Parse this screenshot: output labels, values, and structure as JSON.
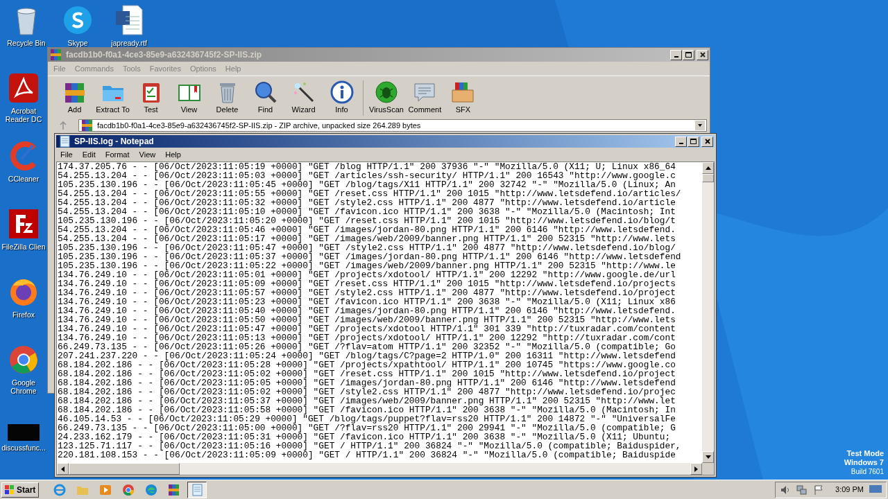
{
  "desktop": {
    "icons": [
      {
        "kind": "recycle-bin",
        "label": "Recycle Bin"
      },
      {
        "kind": "skype",
        "label": "Skype"
      },
      {
        "kind": "word-document",
        "label": "japready.rtf"
      },
      {
        "kind": "acrobat",
        "label": "Acrobat Reader DC"
      },
      {
        "kind": "ccleaner",
        "label": "CCleaner"
      },
      {
        "kind": "filezilla",
        "label": "FileZilla Clien"
      },
      {
        "kind": "firefox",
        "label": "Firefox"
      },
      {
        "kind": "chrome",
        "label": "Google Chrome"
      },
      {
        "kind": "black-file",
        "label": "discussfunc..."
      }
    ],
    "os_notice": [
      "Test Mode",
      "Windows 7",
      "Build 7601"
    ]
  },
  "archiver": {
    "title": "facdb1b0-f0a1-4ce3-85e9-a632436745f2-SP-IIS.zip",
    "menu": [
      "File",
      "Commands",
      "Tools",
      "Favorites",
      "Options",
      "Help"
    ],
    "toolbar_groups": [
      {
        "buttons": [
          {
            "kind": "add",
            "label": "Add"
          },
          {
            "kind": "extract",
            "label": "Extract To"
          },
          {
            "kind": "test",
            "label": "Test"
          },
          {
            "kind": "view",
            "label": "View"
          },
          {
            "kind": "delete",
            "label": "Delete"
          },
          {
            "kind": "find",
            "label": "Find"
          },
          {
            "kind": "wizard",
            "label": "Wizard"
          },
          {
            "kind": "info",
            "label": "Info"
          }
        ]
      },
      {
        "buttons": [
          {
            "kind": "virusscan",
            "label": "VirusScan"
          },
          {
            "kind": "comment",
            "label": "Comment"
          },
          {
            "kind": "sfx",
            "label": "SFX"
          }
        ]
      }
    ],
    "path": "facdb1b0-f0a1-4ce3-85e9-a632436745f2-SP-IIS.zip - ZIP archive, unpacked size 264.289 bytes"
  },
  "notepad": {
    "title": "SP-IIS.log - Notepad",
    "menu": [
      "File",
      "Edit",
      "Format",
      "View",
      "Help"
    ],
    "lines": [
      "174.37.205.76 - - [06/Oct/2023:11:05:19 +0000] \"GET /blog HTTP/1.1\" 200 37936 \"-\" \"Mozilla/5.0 (X11; U; Linux x86_64",
      "54.255.13.204 - - [06/Oct/2023:11:05:03 +0000] \"GET /articles/ssh-security/ HTTP/1.1\" 200 16543 \"http://www.google.c",
      "105.235.130.196 - - [06/Oct/2023:11:05:45 +0000] \"GET /blog/tags/X11 HTTP/1.1\" 200 32742 \"-\" \"Mozilla/5.0 (Linux; An",
      "54.255.13.204 - - [06/Oct/2023:11:05:55 +0000] \"GET /reset.css HTTP/1.1\" 200 1015 \"http://www.letsdefend.io/articles/",
      "54.255.13.204 - - [06/Oct/2023:11:05:32 +0000] \"GET /style2.css HTTP/1.1\" 200 4877 \"http://www.letsdefend.io/article",
      "54.255.13.204 - - [06/Oct/2023:11:05:10 +0000] \"GET /favicon.ico HTTP/1.1\" 200 3638 \"-\" \"Mozilla/5.0 (Macintosh; Int",
      "105.235.130.196 - - [06/Oct/2023:11:05:20 +0000] \"GET /reset.css HTTP/1.1\" 200 1015 \"http://www.letsdefend.io/blog/t",
      "54.255.13.204 - - [06/Oct/2023:11:05:46 +0000] \"GET /images/jordan-80.png HTTP/1.1\" 200 6146 \"http://www.letsdefend.",
      "54.255.13.204 - - [06/Oct/2023:11:05:17 +0000] \"GET /images/web/2009/banner.png HTTP/1.1\" 200 52315 \"http://www.lets",
      "105.235.130.196 - - [06/Oct/2023:11:05:47 +0000] \"GET /style2.css HTTP/1.1\" 200 4877 \"http://www.letsdefend.io/blog/",
      "105.235.130.196 - - [06/Oct/2023:11:05:37 +0000] \"GET /images/jordan-80.png HTTP/1.1\" 200 6146 \"http://www.letsdefend",
      "105.235.130.196 - - [06/Oct/2023:11:05:22 +0000] \"GET /images/web/2009/banner.png HTTP/1.1\" 200 52315 \"http://www.le",
      "134.76.249.10 - - [06/Oct/2023:11:05:01 +0000] \"GET /projects/xdotool/ HTTP/1.1\" 200 12292 \"http://www.google.de/url",
      "134.76.249.10 - - [06/Oct/2023:11:05:09 +0000] \"GET /reset.css HTTP/1.1\" 200 1015 \"http://www.letsdefend.io/projects",
      "134.76.249.10 - - [06/Oct/2023:11:05:57 +0000] \"GET /style2.css HTTP/1.1\" 200 4877 \"http://www.letsdefend.io/project",
      "134.76.249.10 - - [06/Oct/2023:11:05:23 +0000] \"GET /favicon.ico HTTP/1.1\" 200 3638 \"-\" \"Mozilla/5.0 (X11; Linux x86",
      "134.76.249.10 - - [06/Oct/2023:11:05:40 +0000] \"GET /images/jordan-80.png HTTP/1.1\" 200 6146 \"http://www.letsdefend.",
      "134.76.249.10 - - [06/Oct/2023:11:05:50 +0000] \"GET /images/web/2009/banner.png HTTP/1.1\" 200 52315 \"http://www.lets",
      "134.76.249.10 - - [06/Oct/2023:11:05:47 +0000] \"GET /projects/xdotool HTTP/1.1\" 301 339 \"http://tuxradar.com/content",
      "134.76.249.10 - - [06/Oct/2023:11:05:13 +0000] \"GET /projects/xdotool/ HTTP/1.1\" 200 12292 \"http://tuxradar.com/cont",
      "66.249.73.135 - - [06/Oct/2023:11:05:26 +0000] \"GET /?flav=atom HTTP/1.1\" 200 32352 \"-\" \"Mozilla/5.0 (compatible; Go",
      "207.241.237.220 - - [06/Oct/2023:11:05:24 +0000] \"GET /blog/tags/C?page=2 HTTP/1.0\" 200 16311 \"http://www.letsdefend",
      "68.184.202.186 - - [06/Oct/2023:11:05:28 +0000] \"GET /projects/xpathtool/ HTTP/1.1\" 200 10745 \"https://www.google.co",
      "68.184.202.186 - - [06/Oct/2023:11:05:02 +0000] \"GET /reset.css HTTP/1.1\" 200 1015 \"http://www.letsdefend.io/project",
      "68.184.202.186 - - [06/Oct/2023:11:05:05 +0000] \"GET /images/jordan-80.png HTTP/1.1\" 200 6146 \"http://www.letsdefend",
      "68.184.202.186 - - [06/Oct/2023:11:05:02 +0000] \"GET /style2.css HTTP/1.1\" 200 4877 \"http://www.letsdefend.io/projec",
      "68.184.202.186 - - [06/Oct/2023:11:05:37 +0000] \"GET /images/web/2009/banner.png HTTP/1.1\" 200 52315 \"http://www.let",
      "68.184.202.186 - - [06/Oct/2023:11:05:58 +0000] \"GET /favicon.ico HTTP/1.1\" 200 3638 \"-\" \"Mozilla/5.0 (Macintosh; In",
      "46.105.14.53 - - [06/Oct/2023:11:05:29 +0000] \"GET /blog/tags/puppet?flav=rss20 HTTP/1.1\" 200 14872 \"-\" \"UniversalFe",
      "66.249.73.135 - - [06/Oct/2023:11:05:00 +0000] \"GET /?flav=rss20 HTTP/1.1\" 200 29941 \"-\" \"Mozilla/5.0 (compatible; G",
      "24.233.162.179 - - [06/Oct/2023:11:05:31 +0000] \"GET /favicon.ico HTTP/1.1\" 200 3638 \"-\" \"Mozilla/5.0 (X11; Ubuntu;",
      "123.125.71.117 - - [06/Oct/2023:11:05:16 +0000] \"GET / HTTP/1.1\" 200 36824 \"-\" \"Mozilla/5.0 (compatible; Baiduspider,",
      "220.181.108.153 - - [06/Oct/2023:11:05:09 +0000] \"GET / HTTP/1.1\" 200 36824 \"-\" \"Mozilla/5.0 (compatible; Baiduspide"
    ]
  },
  "taskbar": {
    "start": "Start",
    "apps": [
      {
        "kind": "ie",
        "selected": false
      },
      {
        "kind": "explorer",
        "selected": false
      },
      {
        "kind": "media",
        "selected": false
      },
      {
        "kind": "chrome",
        "selected": false
      },
      {
        "kind": "edge",
        "selected": false
      },
      {
        "kind": "winrar",
        "selected": false
      },
      {
        "kind": "notepad",
        "selected": true
      }
    ],
    "clock": "3:09 PM"
  }
}
